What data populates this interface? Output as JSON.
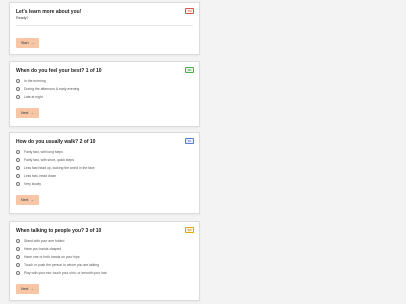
{
  "colors": {
    "button_bg": "#f6c6a6",
    "card_bg": "#ffffff",
    "page_bg": "#f3f3f3"
  },
  "cards": [
    {
      "title": "Let's learn more about you!",
      "subtitle": "Ready?",
      "badge": "TM",
      "badge_color": "red",
      "button_label": "Start",
      "button_icon": "arrow-right-icon",
      "options": []
    },
    {
      "title": "When do you feel your best? 1 of 10",
      "badge": "SK",
      "badge_color": "green",
      "button_label": "Next",
      "button_icon": "arrow-right-icon",
      "options": [
        "In the morning",
        "During the afternoon & early evening",
        "Late at night"
      ]
    },
    {
      "title": "How do you usually walk? 2 of 10",
      "badge": "SL",
      "badge_color": "blue",
      "button_label": "Next",
      "button_icon": "arrow-right-icon",
      "options": [
        "Fairly fast, with long steps",
        "Fairly fast, with short, quick steps",
        "Less fast head up, looking the world in the face",
        "Less fast, head down",
        "Very slowly"
      ]
    },
    {
      "title": "When talking to people you? 3 of 10",
      "badge": "SR",
      "badge_color": "yellow",
      "button_label": "Next",
      "button_icon": "arrow-right-icon",
      "options": [
        "Stand with your arm folded",
        "Have you hands clasped",
        "Have one or both hands on your hips",
        "Touch or push the person to whom you are talking",
        "Play with your ear, touch your chin, or smooth your hair"
      ]
    }
  ]
}
